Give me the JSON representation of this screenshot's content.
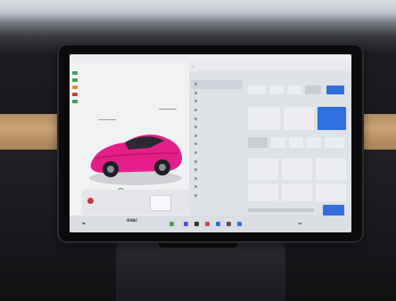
{
  "scene": {
    "colors": {
      "wood": "#c9a377",
      "screen_bg": "#f2f3f5",
      "accent_blue": "#2f6fe0",
      "car": "#e51e8a",
      "lock_green": "#3da15a",
      "alert_red": "#c8373d"
    }
  },
  "screen": {
    "status_left": "",
    "status_center": "",
    "left_callouts": [],
    "lock_text": "",
    "alert_text": "",
    "right_top_labels": [],
    "menu_items": [],
    "taskbar_center": "HVAC",
    "taskbar_center_sub": ""
  }
}
